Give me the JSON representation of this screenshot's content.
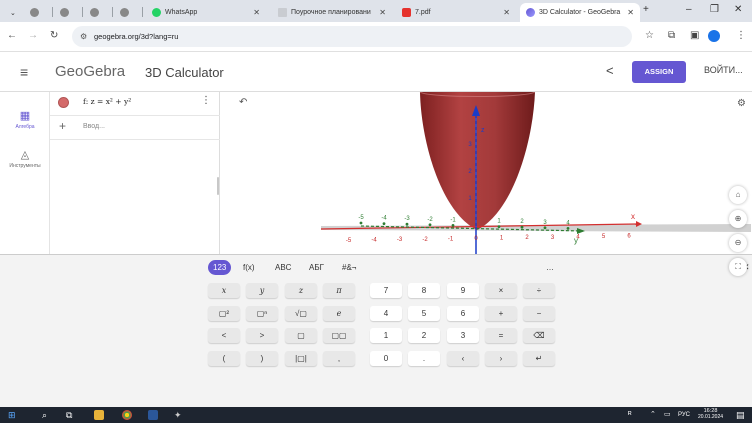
{
  "browser": {
    "tabs": [
      {
        "label": ""
      },
      {
        "label": ""
      },
      {
        "label": ""
      },
      {
        "label": ""
      },
      {
        "label": "WhatsApp"
      },
      {
        "label": "Поурочное планировани"
      },
      {
        "label": "7.pdf"
      },
      {
        "label": "3D Calculator - GeoGebra"
      }
    ],
    "new_tab": "+",
    "url": "geogebra.org/3d?lang=ru",
    "window_controls": {
      "minimize": "–",
      "maximize": "❐",
      "close": "✕"
    }
  },
  "header": {
    "brand": "GeoGebra",
    "app_name": "3D Calculator",
    "assign_label": "ASSIGN",
    "login_label": "ВОЙТИ..."
  },
  "sidebar": {
    "items": [
      {
        "label": "Алгебра",
        "icon": "calculator-icon"
      },
      {
        "label": "Инструменты",
        "icon": "tools-icon"
      }
    ]
  },
  "algebra": {
    "expression": "f: z = x² + y²",
    "input_placeholder": "Ввод...",
    "dot_color": "#d46a6a"
  },
  "graphics": {
    "x_ticks": [
      "-5",
      "-4",
      "-3",
      "-2",
      "-1",
      "0",
      "1",
      "2",
      "3",
      "4",
      "5",
      "6"
    ],
    "y_ticks": [
      "-5",
      "-4",
      "-3",
      "-2",
      "-1",
      "1",
      "2",
      "3",
      "4"
    ],
    "z_ticks": [
      "1",
      "2",
      "3"
    ],
    "x_label": "x",
    "y_label": "y",
    "z_label": "z",
    "surface_color": "#9e2f2f"
  },
  "keyboard": {
    "tabs": [
      "123",
      "f(x)",
      "ABC",
      "АБГ",
      "#&¬"
    ],
    "more": "…",
    "close": "✕",
    "rows": [
      [
        "x",
        "y",
        "z",
        "π",
        "7",
        "8",
        "9",
        "×",
        "÷"
      ],
      [
        "▢²",
        "▢ⁿ",
        "√▢",
        "e",
        "4",
        "5",
        "6",
        "+",
        "−"
      ],
      [
        "<",
        ">",
        "▢",
        "▢▢",
        "1",
        "2",
        "3",
        "=",
        "⌫"
      ],
      [
        "(",
        ")",
        "|▢|",
        ",",
        "0",
        ".",
        "‹",
        "›",
        "↵"
      ]
    ]
  },
  "taskbar": {
    "lang": "РУС",
    "time": "16:28",
    "date": "20.01.2024"
  }
}
